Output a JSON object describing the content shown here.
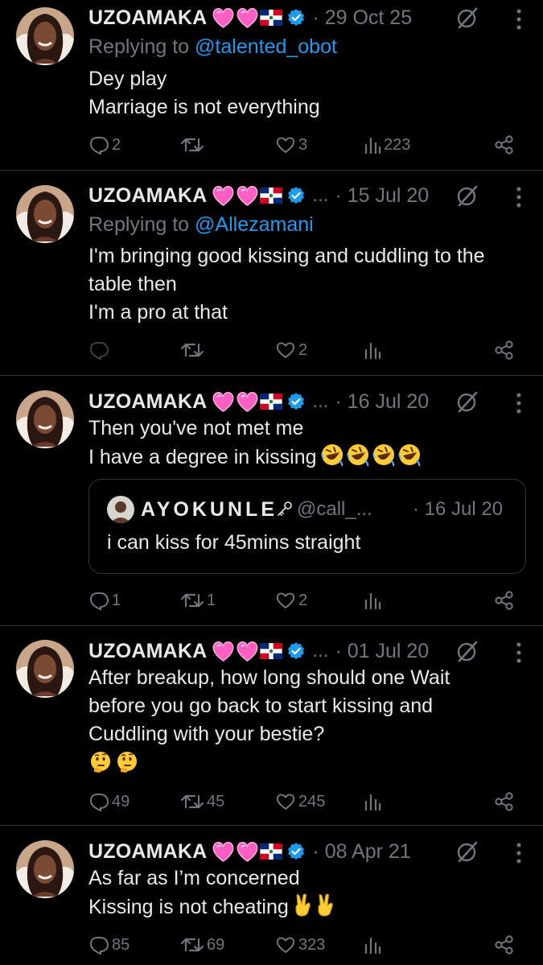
{
  "colors": {
    "background": "#000000",
    "text": "#e7e9ea",
    "muted": "#71767b",
    "link": "#1d9bf0",
    "verified": "#1d9bf0",
    "divider": "#2f3336"
  },
  "tweets": [
    {
      "name": "UZOAMAKA",
      "ellipsis": "",
      "date": "· 29 Oct 25",
      "reply_prefix": "Replying to ",
      "reply_handle": "@talented_obot",
      "lines": [
        "Dey play",
        "Marriage is not everything"
      ],
      "replies": "2",
      "reposts": "",
      "likes": "3",
      "views": "223"
    },
    {
      "name": "UZOAMAKA",
      "ellipsis": "...",
      "date": "· 15 Jul 20",
      "reply_prefix": "Replying to ",
      "reply_handle": "@Allezamani",
      "lines": [
        "I'm bringing good kissing and cuddling to the",
        "table then",
        "I'm a pro at that"
      ],
      "replies": "",
      "reposts": "",
      "likes": "2",
      "views": ""
    },
    {
      "name": "UZOAMAKA",
      "ellipsis": "...",
      "date": "· 16 Jul 20",
      "lines": [
        "Then you've not met me",
        "I have a degree in kissing"
      ],
      "emoji": [
        "rolling-on-floor-laughing",
        "rolling-on-floor-laughing",
        "rolling-on-floor-laughing",
        "rolling-on-floor-laughing"
      ],
      "quote": {
        "name": "AYOKUNLE",
        "handle": "@call_...",
        "date": "· 16 Jul 20",
        "text": "i can kiss for 45mins straight"
      },
      "replies": "1",
      "reposts": "1",
      "likes": "2",
      "views": ""
    },
    {
      "name": "UZOAMAKA",
      "ellipsis": "...",
      "date": "· 01 Jul 20",
      "lines": [
        "After breakup, how long should one Wait",
        "before you go back to start kissing and",
        "Cuddling with your bestie?"
      ],
      "emoji": [
        "thinking-face",
        "thinking-face"
      ],
      "replies": "49",
      "reposts": "45",
      "likes": "245",
      "views": ""
    },
    {
      "name": "UZOAMAKA",
      "ellipsis": "",
      "date": "· 08 Apr 21",
      "lines": [
        "As far as I’m concerned",
        "Kissing is not cheating"
      ],
      "emoji": [
        "victory-hand",
        "victory-hand"
      ],
      "replies": "85",
      "reposts": "69",
      "likes": "323",
      "views": ""
    }
  ]
}
